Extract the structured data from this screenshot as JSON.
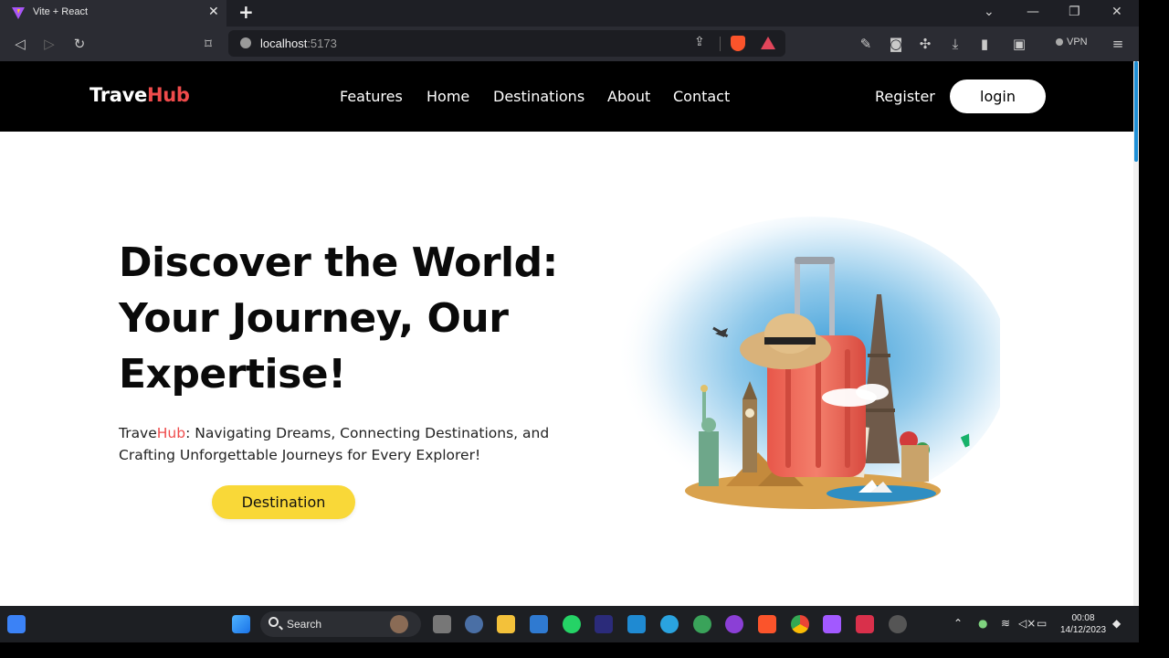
{
  "browser": {
    "tab_title": "Vite + React",
    "tab_close": "✕",
    "new_tab": "+",
    "url_host": "localhost",
    "url_port": ":5173",
    "vpn_label": "VPN",
    "icons": [
      "back-icon",
      "forward-icon",
      "reload-icon",
      "bookmark-icon",
      "info-icon",
      "share-icon",
      "brave-shields-icon",
      "brave-rewards-icon",
      "eyedropper-icon",
      "screenshot-icon",
      "extensions-icon",
      "download-icon",
      "sidebar-icon",
      "wallet-icon",
      "menu-icon"
    ]
  },
  "nav": {
    "logo_part1": "Trave",
    "logo_part2": "Hub",
    "links": [
      "Features",
      "Home",
      "Destinations",
      "About",
      "Contact"
    ],
    "register": "Register",
    "login": "login"
  },
  "hero": {
    "title": "Discover the World: Your Journey, Our Expertise!",
    "subtitle_brand_a": "Trave",
    "subtitle_brand_b": "Hub",
    "subtitle_rest": ": Navigating Dreams, Connecting Destinations, and Crafting Unforgettable Journeys for Every Explorer!",
    "cta": "Destination"
  },
  "taskbar": {
    "search_label": "Search",
    "time": "00:08",
    "date": "14/12/2023"
  },
  "colors": {
    "brand_red": "#ef4b4b",
    "cta_yellow": "#f9d838",
    "nav_bg": "#000000",
    "chrome_bg": "#2b2c33"
  }
}
